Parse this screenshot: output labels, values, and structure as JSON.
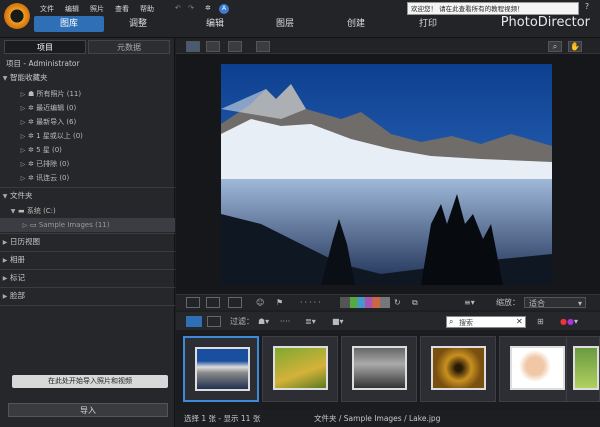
{
  "app": {
    "brand": "PhotoDirector"
  },
  "menu": [
    "文件",
    "编辑",
    "照片",
    "查看",
    "帮助"
  ],
  "nav": {
    "library": "图库",
    "adjust": "调整",
    "edit": "编辑",
    "layers": "图层",
    "create": "创建",
    "print": "打印"
  },
  "tooltip": "欢迎您！ 请在此查看所有的教程视频！",
  "left": {
    "tabs": {
      "projects": "项目",
      "metadata": "元数据"
    },
    "project": "项目 - Administrator",
    "smart_collections": "智能收藏夹",
    "smart_items": [
      "所有照片 (11)",
      "最近编辑 (0)",
      "最新导入 (6)",
      "1 星或以上 (0)",
      "5 星 (0)",
      "已排除 (0)",
      "讯连云 (0)"
    ],
    "folders": "文件夹",
    "drive": "系统 (C:)",
    "sample_folder": "Sample Images (11)",
    "calendar": "日历视图",
    "albums": "相册",
    "tags": "标记",
    "faces": "脸部",
    "hint": "在此处开始导入照片和视频",
    "import": "导入"
  },
  "toolbar": {
    "filter": "过滤：",
    "zoom_label": "缩放：",
    "zoom_value": "适合",
    "search_placeholder": "搜索"
  },
  "status": {
    "selection": "选择 1 张 - 显示 11 张",
    "path": "文件夹 / Sample Images / Lake.jpg"
  },
  "thumbnails": [
    "lake",
    "bicycle-field",
    "dark-landscape",
    "spiral-staircase",
    "portrait",
    "flowers"
  ],
  "colors": {
    "accent": "#2f6fb5",
    "selected_border": "#3c8ad8"
  }
}
